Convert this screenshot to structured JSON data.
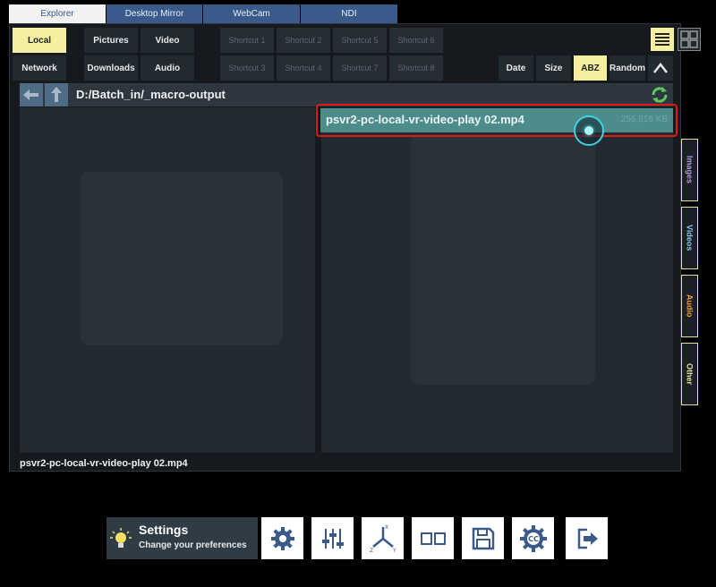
{
  "top_tabs": [
    "Explorer",
    "Desktop Mirror",
    "WebCam",
    "NDI"
  ],
  "locations": {
    "local": "Local",
    "network": "Network",
    "pictures": "Pictures",
    "video": "Video",
    "downloads": "Downloads",
    "audio": "Audio"
  },
  "shortcuts": [
    "Shortcut 1",
    "Shortcut 2",
    "Shortcut 5",
    "Shortcut 6",
    "Shortcut 3",
    "Shortcut 4",
    "Shortcut 7",
    "Shortcut 8"
  ],
  "sort": {
    "date": "Date",
    "size": "Size",
    "abz": "ABZ",
    "random": "Random"
  },
  "path": "D:/Batch_in/_macro-output",
  "file": {
    "name": "psvr2-pc-local-vr-video-play 02.mp4",
    "size": "256,816 KB"
  },
  "side_tabs": [
    {
      "label": "Images",
      "color": "#b89ad8"
    },
    {
      "label": "Videos",
      "color": "#8fc8e8"
    },
    {
      "label": "Audio",
      "color": "#f0a030"
    },
    {
      "label": "Other",
      "color": "#e8e0a0"
    }
  ],
  "status": "psvr2-pc-local-vr-video-play 02.mp4",
  "settings": {
    "title": "Settings",
    "subtitle": "Change your preferences"
  },
  "colors": {
    "accent": "#3a5a8a",
    "selected": "#f4f0a0",
    "file_row": "#4e8c8c",
    "highlight": "#e01818"
  },
  "icons": [
    "bulb-icon",
    "gear-icon",
    "sliders-icon",
    "axes-icon",
    "dual-view-icon",
    "save-icon",
    "subtitles-gear-icon",
    "exit-icon"
  ]
}
